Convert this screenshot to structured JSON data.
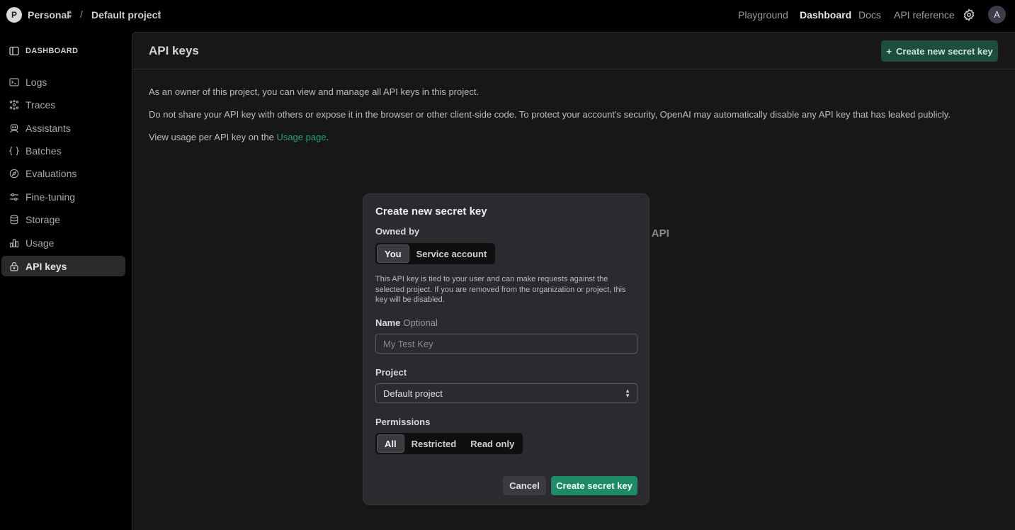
{
  "topbar": {
    "org_initial": "P",
    "org_name": "Personal",
    "separator": "/",
    "project_name": "Default project",
    "nav": [
      "Playground",
      "Dashboard",
      "Docs",
      "API reference"
    ],
    "active_nav": "Dashboard",
    "user_initial": "A"
  },
  "sidebar": {
    "heading": "DASHBOARD",
    "items": [
      {
        "label": "Logs",
        "icon": "terminal-icon"
      },
      {
        "label": "Traces",
        "icon": "traces-icon"
      },
      {
        "label": "Assistants",
        "icon": "assistant-icon"
      },
      {
        "label": "Batches",
        "icon": "batches-icon"
      },
      {
        "label": "Evaluations",
        "icon": "compass-icon"
      },
      {
        "label": "Fine-tuning",
        "icon": "sliders-icon"
      },
      {
        "label": "Storage",
        "icon": "database-icon"
      },
      {
        "label": "Usage",
        "icon": "bar-chart-icon"
      },
      {
        "label": "API keys",
        "icon": "lock-icon"
      }
    ],
    "active_item": "API keys"
  },
  "main": {
    "title": "API keys",
    "create_button": "Create new secret key",
    "para1": "As an owner of this project, you can view and manage all API keys in this project.",
    "para2": "Do not share your API key with others or expose it in the browser or other client-side code. To protect your account's security, OpenAI may automatically disable any API key that has leaked publicly.",
    "para3_prefix": "View usage per API key on the ",
    "para3_link": "Usage page",
    "para3_suffix": ".",
    "obscured_text": "I API"
  },
  "modal": {
    "title": "Create new secret key",
    "owned_by_label": "Owned by",
    "owned_by_options": [
      "You",
      "Service account"
    ],
    "owned_by_selected": "You",
    "description": "This API key is tied to your user and can make requests against the selected project. If you are removed from the organization or project, this key will be disabled.",
    "name_label": "Name",
    "name_optional": "Optional",
    "name_placeholder": "My Test Key",
    "name_value": "",
    "project_label": "Project",
    "project_value": "Default project",
    "permissions_label": "Permissions",
    "permissions_options": [
      "All",
      "Restricted",
      "Read only"
    ],
    "permissions_selected": "All",
    "cancel": "Cancel",
    "submit": "Create secret key"
  },
  "colors": {
    "accent_green": "#1f8a66",
    "link_green": "#2d9f77",
    "header_button_green": "#1e4d3c"
  }
}
